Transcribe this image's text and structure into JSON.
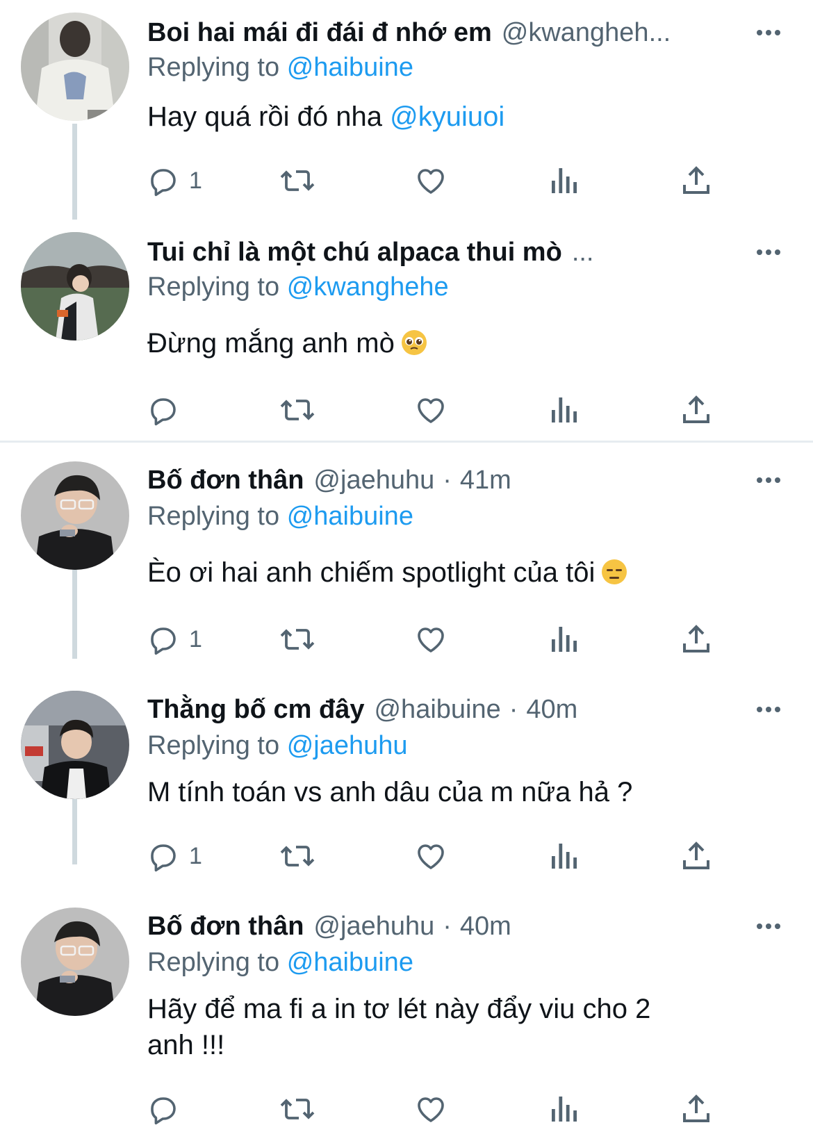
{
  "colors": {
    "link": "#1d9bf0",
    "secondary_text": "#536471",
    "primary_text": "#0f1419",
    "thread_line": "#cfd9de"
  },
  "tweets": [
    {
      "name": "Boi hai mái đi đái đ nhớ em",
      "handle": "@kwangheh...",
      "dot": "",
      "time": "",
      "replying_label": "Replying to",
      "replying_to": "@haibuine",
      "body_text": "Hay quá rồi đó nha ",
      "body_mention": "@kyuiuoi",
      "emoji": "",
      "reply_count": "1"
    },
    {
      "name": "Tui chỉ là một chú alpaca thui mò",
      "handle": "...",
      "dot": "",
      "time": "",
      "replying_label": "Replying to",
      "replying_to": "@kwanghehe",
      "body_text": "Đừng mắng anh mò",
      "body_mention": "",
      "emoji": "pleading-face",
      "reply_count": ""
    },
    {
      "name": "Bố đơn thân",
      "handle": "@jaehuhu",
      "dot": "·",
      "time": "41m",
      "replying_label": "Replying to",
      "replying_to": "@haibuine",
      "body_text": "Èo ơi hai anh chiếm spotlight của tôi",
      "body_mention": "",
      "emoji": "expressionless-face",
      "reply_count": "1"
    },
    {
      "name": "Thằng bố cm đây",
      "handle": "@haibuine",
      "dot": "·",
      "time": "40m",
      "replying_label": "Replying to",
      "replying_to": "@jaehuhu",
      "body_text": "M tính toán vs anh dâu của m nữa hả ?",
      "body_mention": "",
      "emoji": "",
      "reply_count": "1"
    },
    {
      "name": "Bố đơn thân",
      "handle": "@jaehuhu",
      "dot": "·",
      "time": "40m",
      "replying_label": "Replying to",
      "replying_to": "@haibuine",
      "body_text": "Hãy để ma fi a in tơ lét này đẩy viu cho 2 anh !!!",
      "body_mention": "",
      "emoji": "",
      "reply_count": ""
    }
  ],
  "icons": {
    "reply": "reply-icon",
    "retweet": "retweet-icon",
    "like": "heart-icon",
    "views": "analytics-icon",
    "share": "share-icon",
    "more": "more-icon"
  }
}
